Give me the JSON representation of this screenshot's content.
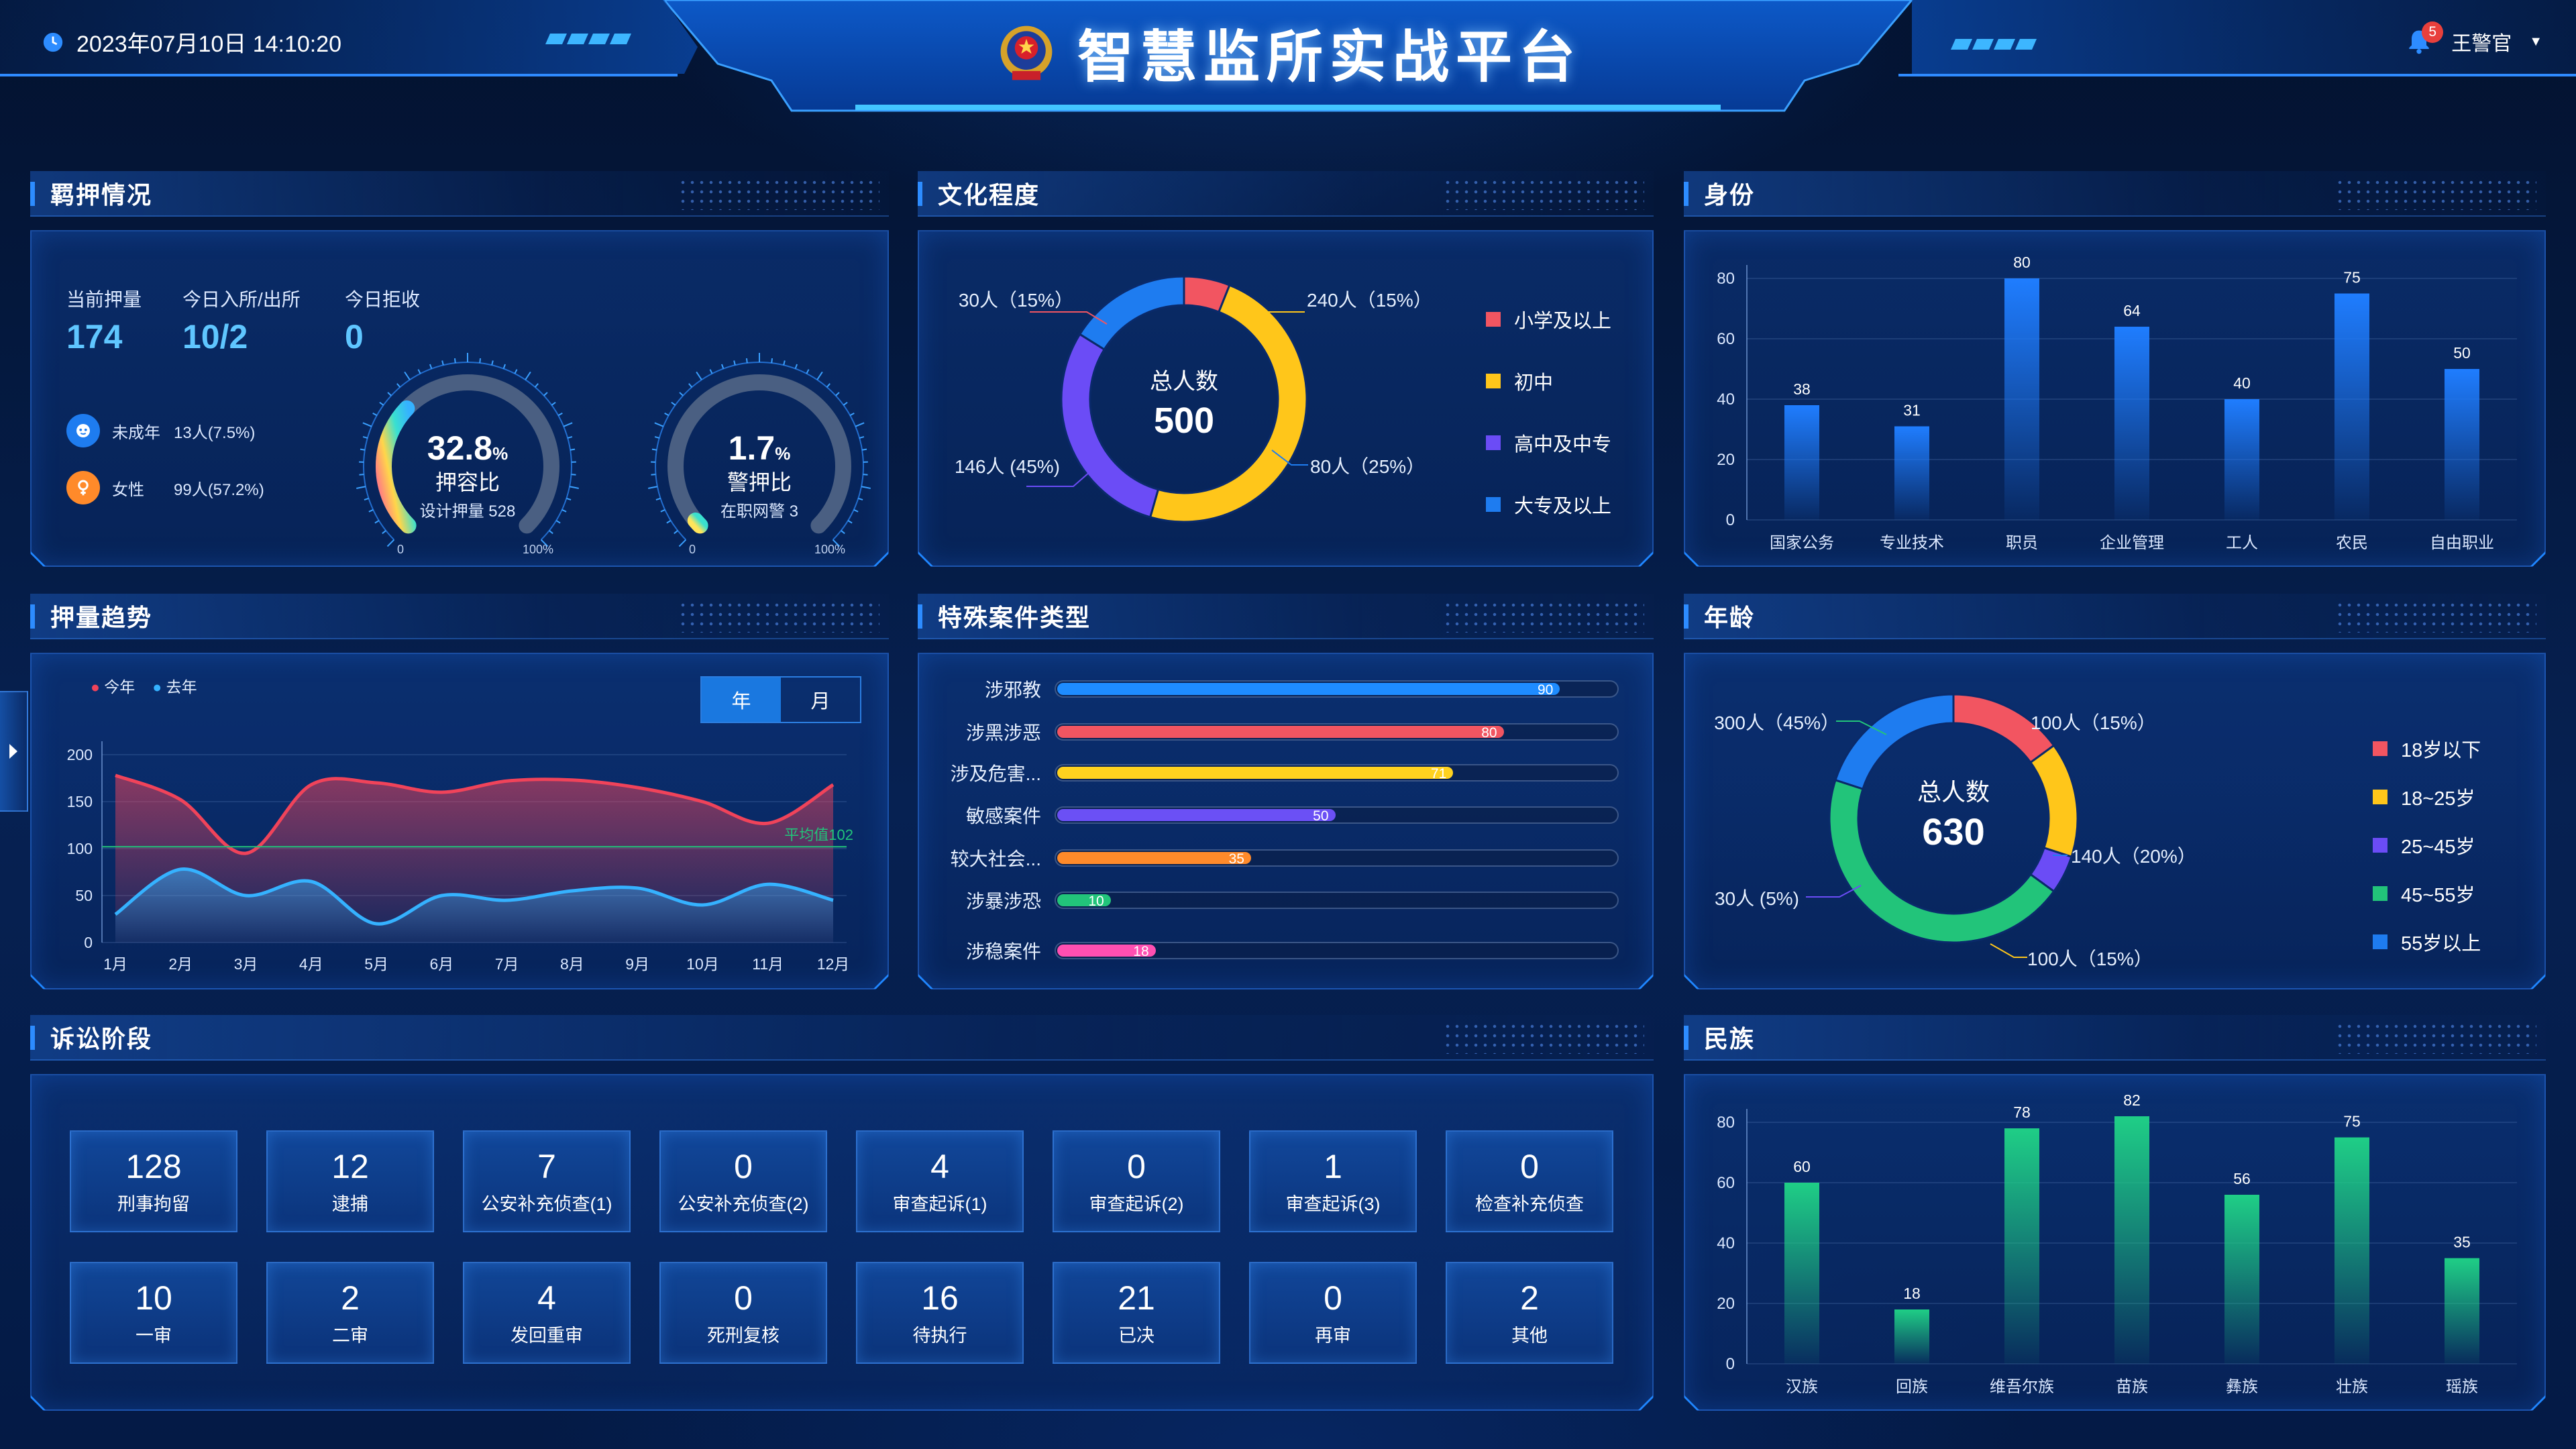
{
  "header": {
    "datetime": "2023年07月10日 14:10:20",
    "title": "智慧监所实战平台",
    "user": "王警官",
    "notification_count": "5",
    "emblem": "police-emblem-icon"
  },
  "detention": {
    "title": "羁押情况",
    "stats": [
      {
        "label": "当前押量",
        "value": "174"
      },
      {
        "label": "今日入所/出所",
        "value": "10/2"
      },
      {
        "label": "今日拒收",
        "value": "0"
      }
    ],
    "minor": {
      "label": "未成年",
      "value": "13人(7.5%)",
      "icon": "child-icon"
    },
    "female": {
      "label": "女性",
      "value": "99人(57.2%)",
      "icon": "female-icon"
    },
    "gauges": [
      {
        "value": "32.8",
        "unit": "%",
        "name": "押容比",
        "sub": "设计押量 528",
        "min": "0",
        "max": "100%",
        "percent": 32.8
      },
      {
        "value": "1.7",
        "unit": "%",
        "name": "警押比",
        "sub": "在职网警 3",
        "min": "0",
        "max": "100%",
        "percent": 1.7
      }
    ]
  },
  "education": {
    "title": "文化程度",
    "center_label": "总人数",
    "center_value": "500",
    "labels": [
      "30人（15%）",
      "240人（15%）",
      "80人（25%）",
      "146人 (45%)"
    ],
    "legend": [
      "小学及以上",
      "初中",
      "高中及中专",
      "大专及以上"
    ]
  },
  "identity": {
    "title": "身份"
  },
  "trend": {
    "title": "押量趋势",
    "legend": [
      "今年",
      "去年"
    ],
    "toggle": [
      "年",
      "月"
    ],
    "avg_label": "平均值102"
  },
  "special_cases": {
    "title": "特殊案件类型",
    "rows": [
      {
        "label": "涉邪教",
        "value": 90,
        "color": "#1e8cff"
      },
      {
        "label": "涉黑涉恶",
        "value": 80,
        "color": "#f25561"
      },
      {
        "label": "涉及危害...",
        "value": 71,
        "color": "#ffd21f"
      },
      {
        "label": "敏感案件",
        "value": 50,
        "color": "#6b50f5"
      },
      {
        "label": "较大社会...",
        "value": 35,
        "color": "#ff8a2a"
      },
      {
        "label": "涉暴涉恐",
        "value": 10,
        "color": "#22c47a"
      },
      {
        "label": "涉稳案件",
        "value": 18,
        "color": "#ff4fb1"
      }
    ]
  },
  "age": {
    "title": "年龄",
    "center_label": "总人数",
    "center_value": "630",
    "labels": [
      "300人（45%）",
      "100人（15%）",
      "140人（20%）",
      "100人（15%）",
      "30人 (5%)"
    ],
    "legend": [
      "18岁以下",
      "18~25岁",
      "25~45岁",
      "45~55岁",
      "55岁以上"
    ]
  },
  "litigation": {
    "title": "诉讼阶段",
    "tiles": [
      {
        "value": "128",
        "label": "刑事拘留"
      },
      {
        "value": "12",
        "label": "逮捕"
      },
      {
        "value": "7",
        "label": "公安补充侦查(1)"
      },
      {
        "value": "0",
        "label": "公安补充侦查(2)"
      },
      {
        "value": "4",
        "label": "审查起诉(1)"
      },
      {
        "value": "0",
        "label": "审查起诉(2)"
      },
      {
        "value": "1",
        "label": "审查起诉(3)"
      },
      {
        "value": "0",
        "label": "检查补充侦查"
      },
      {
        "value": "10",
        "label": "一审"
      },
      {
        "value": "2",
        "label": "二审"
      },
      {
        "value": "4",
        "label": "发回重审"
      },
      {
        "value": "0",
        "label": "死刑复核"
      },
      {
        "value": "16",
        "label": "待执行"
      },
      {
        "value": "21",
        "label": "已决"
      },
      {
        "value": "0",
        "label": "再审"
      },
      {
        "value": "2",
        "label": "其他"
      }
    ]
  },
  "ethnicity": {
    "title": "民族"
  },
  "chart_data": [
    {
      "type": "pie",
      "id": "education",
      "categories": [
        "小学及以上",
        "初中",
        "高中及中专",
        "大专及以上"
      ],
      "values": [
        30,
        240,
        146,
        80
      ],
      "colors": [
        "#f25561",
        "#ffc61a",
        "#6b4cf6",
        "#1e7cf0"
      ]
    },
    {
      "type": "bar",
      "id": "identity",
      "categories": [
        "国家公务",
        "专业技术",
        "职员",
        "企业管理",
        "工人",
        "农民",
        "自由职业"
      ],
      "values": [
        38,
        31,
        80,
        64,
        40,
        75,
        50
      ],
      "ylim": [
        0,
        80
      ],
      "yticks": [
        0,
        20,
        40,
        60,
        80
      ],
      "color": "#1f7dff"
    },
    {
      "type": "line",
      "id": "trend",
      "categories": [
        "1月",
        "2月",
        "3月",
        "4月",
        "5月",
        "6月",
        "7月",
        "8月",
        "9月",
        "10月",
        "11月",
        "12月"
      ],
      "series": [
        {
          "name": "今年",
          "values": [
            178,
            152,
            95,
            168,
            170,
            160,
            172,
            173,
            165,
            150,
            127,
            168
          ],
          "color": "#f0435a"
        },
        {
          "name": "去年",
          "values": [
            30,
            78,
            50,
            65,
            20,
            50,
            45,
            55,
            58,
            40,
            62,
            45
          ],
          "color": "#35b2ff"
        }
      ],
      "ylim": [
        0,
        200
      ],
      "yticks": [
        0,
        50,
        100,
        150,
        200
      ],
      "average": 102
    },
    {
      "type": "pie",
      "id": "age",
      "categories": [
        "18岁以下",
        "18~25岁",
        "25~45岁",
        "45~55岁",
        "55岁以上"
      ],
      "values": [
        15,
        15,
        5,
        45,
        20
      ],
      "colors": [
        "#f25561",
        "#ffc61a",
        "#6b4cf6",
        "#22c47a",
        "#1e7cf0"
      ]
    },
    {
      "type": "bar",
      "id": "ethnicity",
      "categories": [
        "汉族",
        "回族",
        "维吾尔族",
        "苗族",
        "彝族",
        "壮族",
        "瑶族"
      ],
      "values": [
        60,
        18,
        78,
        82,
        56,
        75,
        35
      ],
      "ylim": [
        0,
        80
      ],
      "yticks": [
        0,
        20,
        40,
        60,
        80
      ],
      "color": "#1fce86"
    }
  ]
}
